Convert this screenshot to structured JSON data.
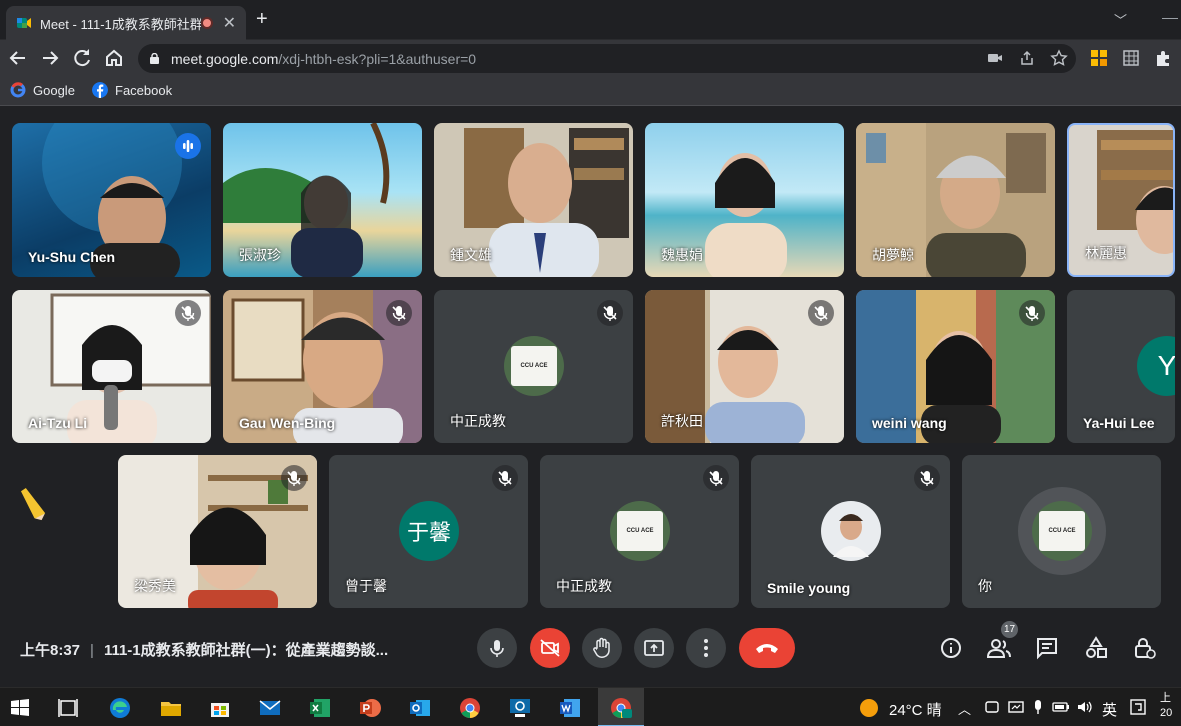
{
  "browser": {
    "tab_title": "Meet - 111-1成教系教師社群",
    "tab_close": "✕",
    "new_tab": "+",
    "tab_menu": "﹀",
    "url_host": "meet.google.com",
    "url_path": "/xdj-htbh-esk?pli=1&authuser=0",
    "bookmarks": [
      {
        "label": "Google"
      },
      {
        "label": "Facebook"
      }
    ]
  },
  "tiles": [
    {
      "name": "Yu-Shu Chen",
      "state": "speaking"
    },
    {
      "name": "張淑珍"
    },
    {
      "name": "鍾文雄"
    },
    {
      "name": "魏惠娟"
    },
    {
      "name": "胡夢鯨"
    },
    {
      "name": "林麗惠"
    },
    {
      "name": "Ai-Tzu Li",
      "state": "muted"
    },
    {
      "name": "Gau Wen-Bing",
      "state": "muted"
    },
    {
      "name": "中正成教",
      "state": "muted"
    },
    {
      "name": "許秋田",
      "state": "muted"
    },
    {
      "name": "weini wang",
      "state": "muted"
    },
    {
      "name": "Ya-Hui Lee",
      "initial": "Y"
    },
    {
      "name": "梁秀美",
      "state": "muted"
    },
    {
      "name": "曾于馨",
      "initial": "于馨",
      "state": "muted"
    },
    {
      "name": "中正成教",
      "state": "muted"
    },
    {
      "name": "Smile young",
      "state": "muted"
    },
    {
      "name": "你"
    }
  ],
  "logo": {
    "line1": "CCU ACE"
  },
  "meeting": {
    "time": "上午8:37",
    "separator": "|",
    "title": "111-1成教系教師社群(一)：從產業趨勢談...",
    "participant_count": "17"
  },
  "taskbar": {
    "weather": "24°C 晴",
    "ime": "英",
    "clock_top": "上",
    "clock_bottom": "20"
  },
  "colors": {
    "meet_bg": "#202124",
    "tile_bg": "#3c4043",
    "red": "#ea4335",
    "speaking": "#1a73e8",
    "avatar_teal": "#00796b"
  }
}
